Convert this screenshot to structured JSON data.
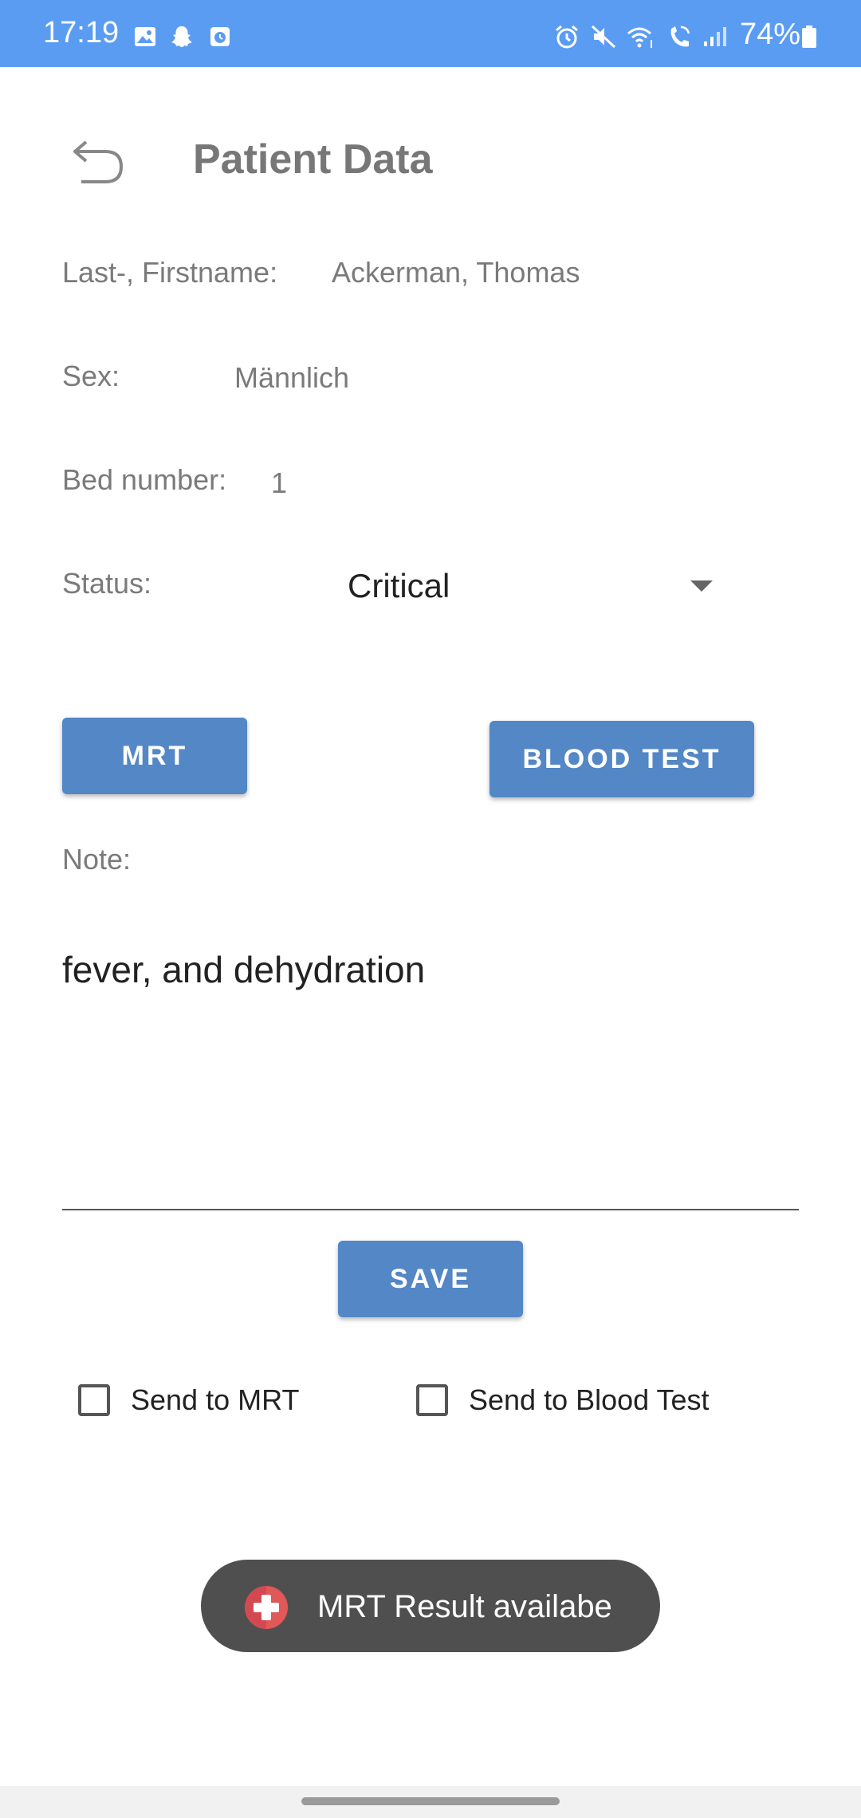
{
  "status_bar": {
    "time": "17:19",
    "battery": "74%",
    "left_icons": [
      "gallery-icon",
      "snapchat-icon",
      "clock-app-icon"
    ],
    "right_icons": [
      "alarm-icon",
      "mute-icon",
      "wifi-calling-icon",
      "volte-call-icon",
      "signal-icon",
      "battery-icon"
    ],
    "color": "#5b9cf3"
  },
  "header": {
    "back_icon": "back-arrow-icon",
    "title": "Patient Data"
  },
  "form": {
    "name_label": "Last-, Firstname:",
    "name_value": "Ackerman, Thomas",
    "sex_label": "Sex:",
    "sex_value": "Männlich",
    "bed_label": "Bed number:",
    "bed_value": "1",
    "status_label": "Status:",
    "status_value": "Critical",
    "note_label": "Note:",
    "note_value": "fever, and dehydration"
  },
  "buttons": {
    "mrt": "MRT",
    "blood_test": "BLOOD TEST",
    "save": "SAVE",
    "color": "#5387c6"
  },
  "checkboxes": {
    "send_mrt": {
      "label": "Send to MRT",
      "checked": false
    },
    "send_blood": {
      "label": "Send to Blood Test",
      "checked": false
    }
  },
  "toast": {
    "icon": "medical-cross-icon",
    "text": "MRT Result availabe"
  }
}
